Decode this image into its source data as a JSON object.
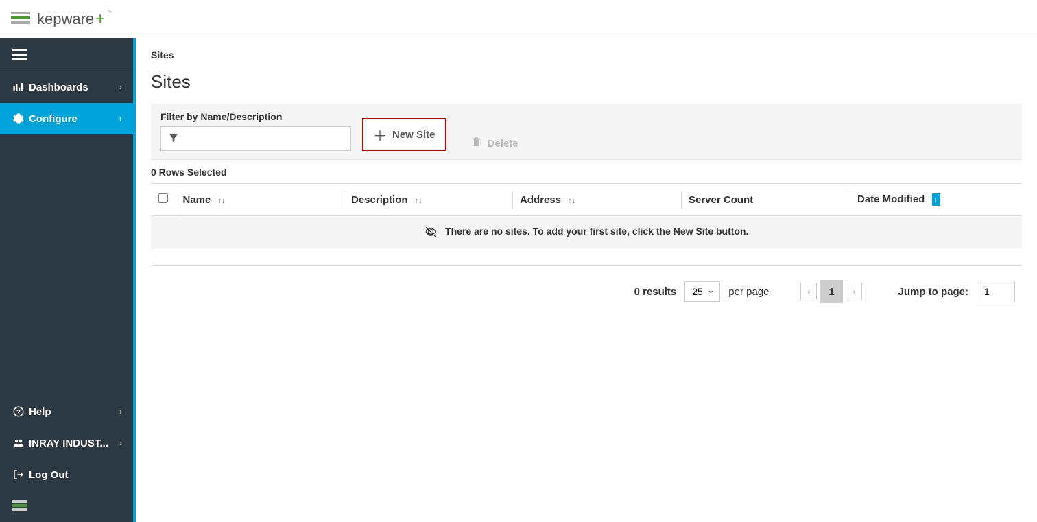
{
  "brand": {
    "name": "kepware",
    "suffix": "+"
  },
  "sidebar": {
    "items": [
      {
        "label": "Dashboards",
        "hasChevron": true
      },
      {
        "label": "Configure",
        "hasChevron": true,
        "active": true
      },
      {
        "label": "Help",
        "hasChevron": true
      },
      {
        "label": "INRAY INDUST...",
        "hasChevron": true
      },
      {
        "label": "Log Out",
        "hasChevron": false
      }
    ]
  },
  "breadcrumb": "Sites",
  "pageTitle": "Sites",
  "toolbar": {
    "filterLabel": "Filter by Name/Description",
    "filterValue": "",
    "newSiteLabel": "New Site",
    "deleteLabel": "Delete"
  },
  "rowsSelectedText": "0 Rows Selected",
  "table": {
    "columns": {
      "name": "Name",
      "description": "Description",
      "address": "Address",
      "serverCount": "Server Count",
      "dateModified": "Date Modified"
    },
    "emptyMessage": "There are no sites. To add your first site, click the New Site button."
  },
  "pagination": {
    "resultsText": "0 results",
    "perPageValue": "25",
    "perPageText": "per page",
    "currentPage": "1",
    "jumpLabel": "Jump to page:",
    "jumpValue": "1"
  }
}
